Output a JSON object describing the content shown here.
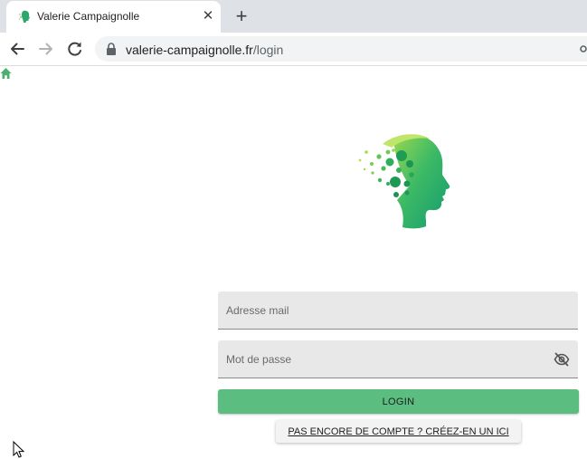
{
  "browser": {
    "tab_title": "Valerie Campaignolle",
    "close_glyph": "✕",
    "new_tab_glyph": "+",
    "url_domain": "valerie-campaignolle.fr",
    "url_path": "/login"
  },
  "icons": {
    "favicon": "head-logo-icon",
    "back": "arrow-left-icon",
    "forward": "arrow-right-icon",
    "reload": "reload-icon",
    "lock": "lock-icon",
    "home": "home-icon",
    "password_toggle": "eye-off-icon"
  },
  "colors": {
    "accent_green": "#5bbd80",
    "logo_green_dark": "#1e9e63",
    "logo_green_light": "#8fd64f",
    "field_bg": "#e8e8e8"
  },
  "login_form": {
    "email_placeholder": "Adresse mail",
    "password_placeholder": "Mot de passe",
    "login_label": "LOGIN",
    "signup_label": "PAS ENCORE DE COMPTE ? CRÉEZ-EN UN ICI"
  }
}
